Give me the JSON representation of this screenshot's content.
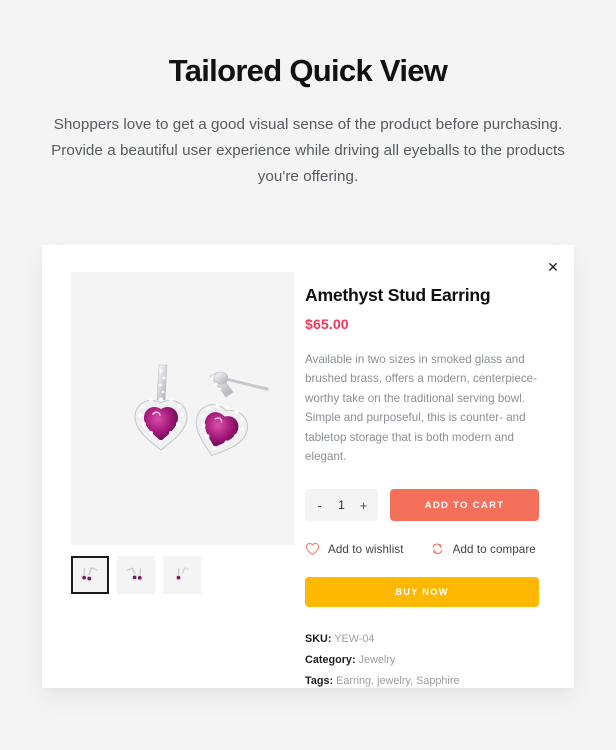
{
  "header": {
    "title": "Tailored Quick View",
    "subtitle": "Shoppers love to get a good visual sense of the product before purchasing. Provide a beautiful user experience while driving all eyeballs to the products you're offering."
  },
  "quickview": {
    "close_label": "✕",
    "close_icon": "close-icon",
    "gallery": {
      "main_image_alt": "Amethyst heart stud earrings pair",
      "thumbnails": [
        {
          "alt": "Amethyst stud earrings view 1",
          "selected": true
        },
        {
          "alt": "Amethyst stud earrings view 2",
          "selected": false
        },
        {
          "alt": "Amethyst stud earrings view 3",
          "selected": false
        }
      ]
    },
    "product": {
      "title": "Amethyst Stud Earring",
      "price": "$65.00",
      "description": "Available in two sizes in smoked glass and brushed brass, offers a modern, centerpiece-worthy take on the traditional serving bowl. Simple and purposeful, this is counter- and tabletop storage that is both modern and elegant."
    },
    "quantity": {
      "decrement_label": "-",
      "value": "1",
      "increment_label": "+"
    },
    "buttons": {
      "add_to_cart": "ADD TO CART",
      "buy_now": "BUY NOW"
    },
    "actions": [
      {
        "label": "Add to wishlist",
        "icon": "heart-icon"
      },
      {
        "label": "Add to compare",
        "icon": "compare-arrows-icon"
      }
    ],
    "meta": [
      {
        "key": "SKU:",
        "value": "YEW-04"
      },
      {
        "key": "Category:",
        "value": "Jewelry"
      },
      {
        "key": "Tags:",
        "value": "Earring, jewelry, Sapphire"
      }
    ]
  },
  "colors": {
    "page_background": "#f4f4f4",
    "card_background": "#ffffff",
    "price": "#f7365a",
    "add_to_cart": "#f4705a",
    "buy_now": "#ffb800",
    "accent_icon": "#f4705a",
    "gem": "#8e1b63"
  }
}
